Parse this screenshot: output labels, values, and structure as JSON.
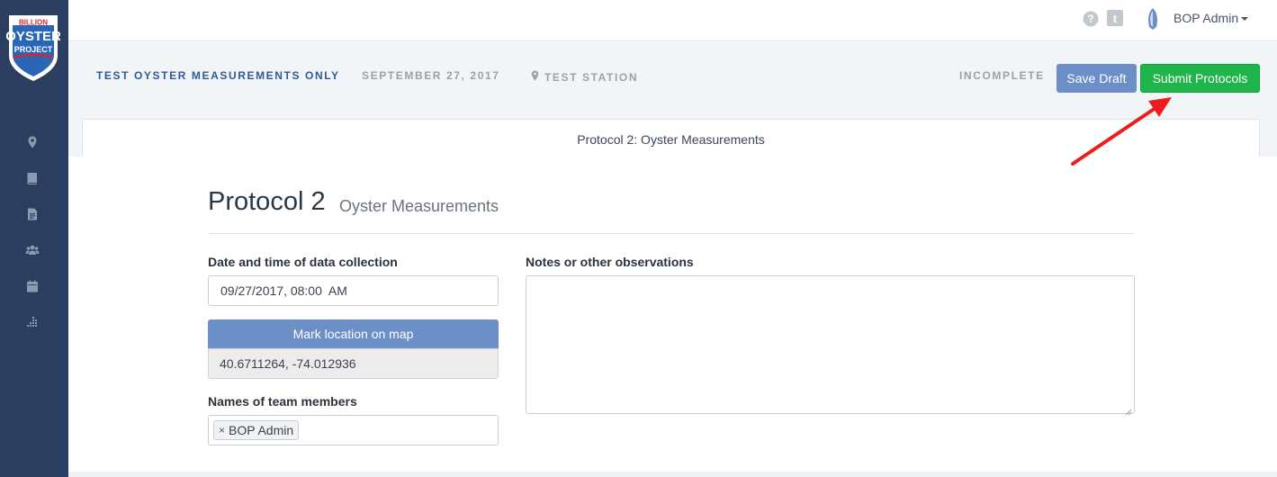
{
  "brand": {
    "logo_lines": [
      "BILLION",
      "OYSTER",
      "PROJECT"
    ]
  },
  "sidebar": {
    "items": [
      {
        "icon": "map-marker-icon"
      },
      {
        "icon": "book-icon"
      },
      {
        "icon": "document-icon"
      },
      {
        "icon": "users-icon"
      },
      {
        "icon": "calendar-icon"
      },
      {
        "icon": "chart-icon"
      }
    ]
  },
  "topbar": {
    "user_name": "BOP Admin"
  },
  "header": {
    "expedition": "TEST OYSTER MEASUREMENTS ONLY",
    "date": "SEPTEMBER 27, 2017",
    "station": "TEST STATION",
    "status": "INCOMPLETE",
    "save_draft_label": "Save Draft",
    "submit_label": "Submit Protocols"
  },
  "tabs": [
    {
      "label": "Protocol 2: Oyster Measurements"
    }
  ],
  "form": {
    "title": "Protocol 2",
    "subtitle": "Oyster Measurements",
    "date_label": "Date and time of data collection",
    "date_value": "09/27/2017, 08:00  AM",
    "map_button_label": "Mark location on map",
    "coordinates": "40.6711264, -74.012936",
    "team_label": "Names of team members",
    "team_members": [
      "BOP Admin"
    ],
    "notes_label": "Notes or other observations",
    "notes_value": ""
  },
  "colors": {
    "sidebar_bg": "#2c3e5f",
    "primary_blue": "#6d8fc8",
    "submit_green": "#1fb54a",
    "title_blue": "#2d5a9a",
    "annotation_red": "#ee1c1c"
  }
}
